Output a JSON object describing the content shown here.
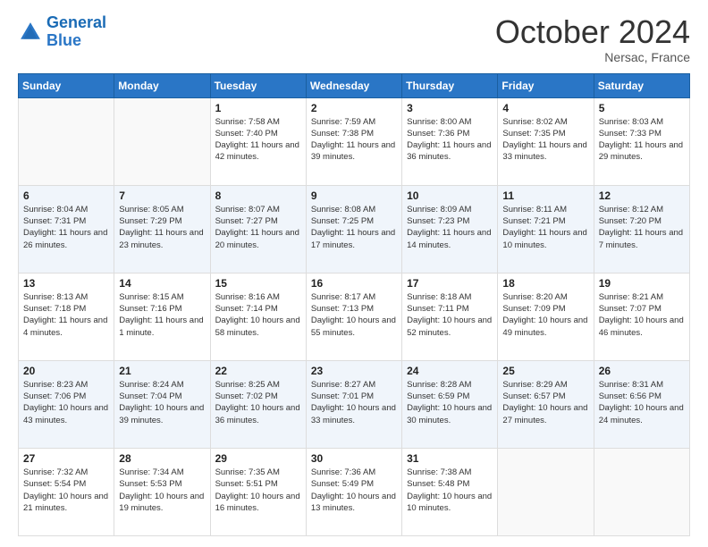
{
  "logo": {
    "text_general": "General",
    "text_blue": "Blue"
  },
  "header": {
    "month": "October 2024",
    "location": "Nersac, France"
  },
  "weekdays": [
    "Sunday",
    "Monday",
    "Tuesday",
    "Wednesday",
    "Thursday",
    "Friday",
    "Saturday"
  ],
  "weeks": [
    [
      {
        "day": "",
        "sunrise": "",
        "sunset": "",
        "daylight": ""
      },
      {
        "day": "",
        "sunrise": "",
        "sunset": "",
        "daylight": ""
      },
      {
        "day": "1",
        "sunrise": "Sunrise: 7:58 AM",
        "sunset": "Sunset: 7:40 PM",
        "daylight": "Daylight: 11 hours and 42 minutes."
      },
      {
        "day": "2",
        "sunrise": "Sunrise: 7:59 AM",
        "sunset": "Sunset: 7:38 PM",
        "daylight": "Daylight: 11 hours and 39 minutes."
      },
      {
        "day": "3",
        "sunrise": "Sunrise: 8:00 AM",
        "sunset": "Sunset: 7:36 PM",
        "daylight": "Daylight: 11 hours and 36 minutes."
      },
      {
        "day": "4",
        "sunrise": "Sunrise: 8:02 AM",
        "sunset": "Sunset: 7:35 PM",
        "daylight": "Daylight: 11 hours and 33 minutes."
      },
      {
        "day": "5",
        "sunrise": "Sunrise: 8:03 AM",
        "sunset": "Sunset: 7:33 PM",
        "daylight": "Daylight: 11 hours and 29 minutes."
      }
    ],
    [
      {
        "day": "6",
        "sunrise": "Sunrise: 8:04 AM",
        "sunset": "Sunset: 7:31 PM",
        "daylight": "Daylight: 11 hours and 26 minutes."
      },
      {
        "day": "7",
        "sunrise": "Sunrise: 8:05 AM",
        "sunset": "Sunset: 7:29 PM",
        "daylight": "Daylight: 11 hours and 23 minutes."
      },
      {
        "day": "8",
        "sunrise": "Sunrise: 8:07 AM",
        "sunset": "Sunset: 7:27 PM",
        "daylight": "Daylight: 11 hours and 20 minutes."
      },
      {
        "day": "9",
        "sunrise": "Sunrise: 8:08 AM",
        "sunset": "Sunset: 7:25 PM",
        "daylight": "Daylight: 11 hours and 17 minutes."
      },
      {
        "day": "10",
        "sunrise": "Sunrise: 8:09 AM",
        "sunset": "Sunset: 7:23 PM",
        "daylight": "Daylight: 11 hours and 14 minutes."
      },
      {
        "day": "11",
        "sunrise": "Sunrise: 8:11 AM",
        "sunset": "Sunset: 7:21 PM",
        "daylight": "Daylight: 11 hours and 10 minutes."
      },
      {
        "day": "12",
        "sunrise": "Sunrise: 8:12 AM",
        "sunset": "Sunset: 7:20 PM",
        "daylight": "Daylight: 11 hours and 7 minutes."
      }
    ],
    [
      {
        "day": "13",
        "sunrise": "Sunrise: 8:13 AM",
        "sunset": "Sunset: 7:18 PM",
        "daylight": "Daylight: 11 hours and 4 minutes."
      },
      {
        "day": "14",
        "sunrise": "Sunrise: 8:15 AM",
        "sunset": "Sunset: 7:16 PM",
        "daylight": "Daylight: 11 hours and 1 minute."
      },
      {
        "day": "15",
        "sunrise": "Sunrise: 8:16 AM",
        "sunset": "Sunset: 7:14 PM",
        "daylight": "Daylight: 10 hours and 58 minutes."
      },
      {
        "day": "16",
        "sunrise": "Sunrise: 8:17 AM",
        "sunset": "Sunset: 7:13 PM",
        "daylight": "Daylight: 10 hours and 55 minutes."
      },
      {
        "day": "17",
        "sunrise": "Sunrise: 8:18 AM",
        "sunset": "Sunset: 7:11 PM",
        "daylight": "Daylight: 10 hours and 52 minutes."
      },
      {
        "day": "18",
        "sunrise": "Sunrise: 8:20 AM",
        "sunset": "Sunset: 7:09 PM",
        "daylight": "Daylight: 10 hours and 49 minutes."
      },
      {
        "day": "19",
        "sunrise": "Sunrise: 8:21 AM",
        "sunset": "Sunset: 7:07 PM",
        "daylight": "Daylight: 10 hours and 46 minutes."
      }
    ],
    [
      {
        "day": "20",
        "sunrise": "Sunrise: 8:23 AM",
        "sunset": "Sunset: 7:06 PM",
        "daylight": "Daylight: 10 hours and 43 minutes."
      },
      {
        "day": "21",
        "sunrise": "Sunrise: 8:24 AM",
        "sunset": "Sunset: 7:04 PM",
        "daylight": "Daylight: 10 hours and 39 minutes."
      },
      {
        "day": "22",
        "sunrise": "Sunrise: 8:25 AM",
        "sunset": "Sunset: 7:02 PM",
        "daylight": "Daylight: 10 hours and 36 minutes."
      },
      {
        "day": "23",
        "sunrise": "Sunrise: 8:27 AM",
        "sunset": "Sunset: 7:01 PM",
        "daylight": "Daylight: 10 hours and 33 minutes."
      },
      {
        "day": "24",
        "sunrise": "Sunrise: 8:28 AM",
        "sunset": "Sunset: 6:59 PM",
        "daylight": "Daylight: 10 hours and 30 minutes."
      },
      {
        "day": "25",
        "sunrise": "Sunrise: 8:29 AM",
        "sunset": "Sunset: 6:57 PM",
        "daylight": "Daylight: 10 hours and 27 minutes."
      },
      {
        "day": "26",
        "sunrise": "Sunrise: 8:31 AM",
        "sunset": "Sunset: 6:56 PM",
        "daylight": "Daylight: 10 hours and 24 minutes."
      }
    ],
    [
      {
        "day": "27",
        "sunrise": "Sunrise: 7:32 AM",
        "sunset": "Sunset: 5:54 PM",
        "daylight": "Daylight: 10 hours and 21 minutes."
      },
      {
        "day": "28",
        "sunrise": "Sunrise: 7:34 AM",
        "sunset": "Sunset: 5:53 PM",
        "daylight": "Daylight: 10 hours and 19 minutes."
      },
      {
        "day": "29",
        "sunrise": "Sunrise: 7:35 AM",
        "sunset": "Sunset: 5:51 PM",
        "daylight": "Daylight: 10 hours and 16 minutes."
      },
      {
        "day": "30",
        "sunrise": "Sunrise: 7:36 AM",
        "sunset": "Sunset: 5:49 PM",
        "daylight": "Daylight: 10 hours and 13 minutes."
      },
      {
        "day": "31",
        "sunrise": "Sunrise: 7:38 AM",
        "sunset": "Sunset: 5:48 PM",
        "daylight": "Daylight: 10 hours and 10 minutes."
      },
      {
        "day": "",
        "sunrise": "",
        "sunset": "",
        "daylight": ""
      },
      {
        "day": "",
        "sunrise": "",
        "sunset": "",
        "daylight": ""
      }
    ]
  ]
}
